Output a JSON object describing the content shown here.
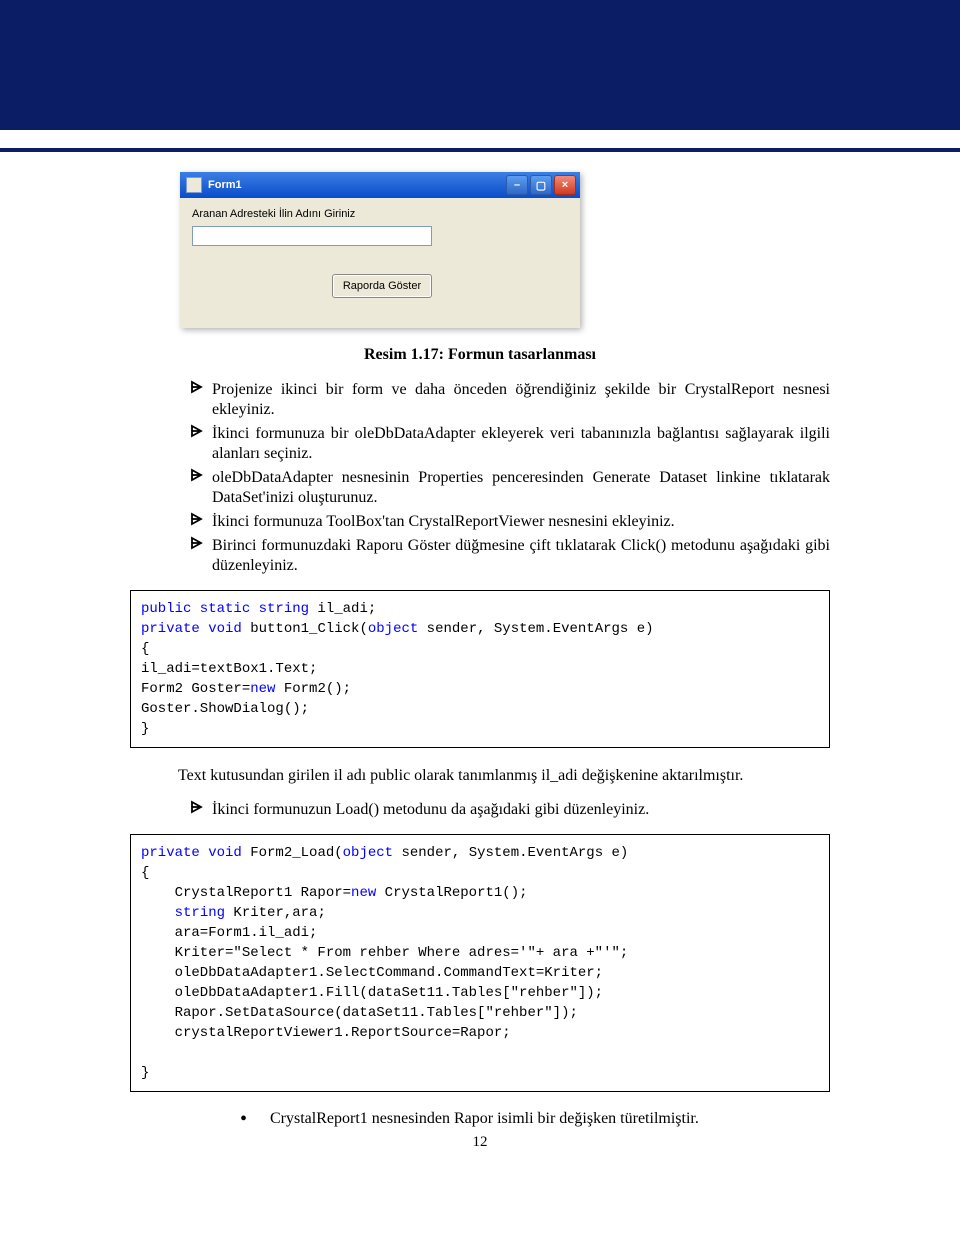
{
  "header": {},
  "winform": {
    "title": "Form1",
    "label": "Aranan Adresteki İlin Adını Giriniz",
    "input_value": "",
    "button": "Raporda Göster"
  },
  "caption": "Resim 1.17: Formun tasarlanması",
  "bullets1": [
    "Projenize ikinci bir form ve daha önceden öğrendiğiniz şekilde bir CrystalReport nesnesi ekleyiniz.",
    "İkinci formunuza bir oleDbDataAdapter ekleyerek veri tabanınızla bağlantısı sağlayarak ilgili alanları seçiniz.",
    "oleDbDataAdapter nesnesinin Properties penceresinden Generate Dataset linkine tıklatarak DataSet'inizi oluşturunuz.",
    "İkinci formunuza ToolBox'tan CrystalReportViewer nesnesini ekleyiniz.",
    "Birinci formunuzdaki Raporu Göster düğmesine çift tıklatarak Click() metodunu aşağıdaki gibi düzenleyiniz."
  ],
  "code1": {
    "line1_pre": "public static string",
    "line1_post": " il_adi;",
    "line2_pre": "private void",
    "line2_mid": " button1_Click(",
    "line2_obj": "object",
    "line2_post": " sender, System.EventArgs e)",
    "line3": "{",
    "line4": "il_adi=textBox1.Text;",
    "line5": "Form2 Goster=",
    "line5_new": "new",
    "line5_end": " Form2();",
    "line6": "Goster.ShowDialog();",
    "line7": "}"
  },
  "para1": "Text kutusundan girilen il adı public olarak tanımlanmış il_adi değişkenine aktarılmıştır.",
  "bullets2": [
    "İkinci formunuzun Load() metodunu da aşağıdaki gibi düzenleyiniz."
  ],
  "code2": {
    "l1_pre": "private void",
    "l1_mid": " Form2_Load(",
    "l1_obj": "object",
    "l1_post": " sender, System.EventArgs e)",
    "l2": "{",
    "l3a": "    CrystalReport1 Rapor=",
    "l3_new": "new",
    "l3b": " CrystalReport1();",
    "l4a": "    ",
    "l4_str": "string",
    "l4b": " Kriter,ara;",
    "l5": "    ara=Form1.il_adi;",
    "l6": "    Kriter=\"Select * From rehber Where adres='\"+ ara +\"'\";",
    "l7": "    oleDbDataAdapter1.SelectCommand.CommandText=Kriter;",
    "l8": "    oleDbDataAdapter1.Fill(dataSet11.Tables[\"rehber\"]);",
    "l9": "    Rapor.SetDataSource(dataSet11.Tables[\"rehber\"]);",
    "l10": "    crystalReportViewer1.ReportSource=Rapor;",
    "l11": "",
    "l12": "}"
  },
  "dot_bullet": "CrystalReport1 nesnesinden Rapor isimli bir değişken türetilmiştir.",
  "page": "12"
}
